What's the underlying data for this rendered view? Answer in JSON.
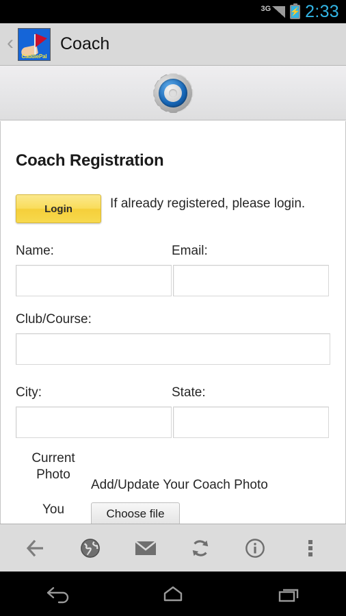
{
  "status_bar": {
    "network": "3G",
    "time": "2:33",
    "battery_icon": "battery-charging-icon",
    "signal_icon": "signal-bars-icon",
    "accent_color": "#33b5e5"
  },
  "title_bar": {
    "back_icon": "back-chevron-icon",
    "app_icon_label": "CaddiePal",
    "title": "Coach"
  },
  "banner": {
    "icon": "gear-icon"
  },
  "main": {
    "page_title": "Coach Registration",
    "login_button": "Login",
    "login_note": "If already registered, please login.",
    "fields": [
      {
        "label": "Name:",
        "value": "",
        "placeholder": ""
      },
      {
        "label": "Email:",
        "value": "",
        "placeholder": ""
      },
      {
        "label": "Club/Course:",
        "value": "",
        "placeholder": ""
      },
      {
        "label": "City:",
        "value": "",
        "placeholder": ""
      },
      {
        "label": "State:",
        "value": "",
        "placeholder": ""
      }
    ],
    "photo": {
      "current_photo_label": "Current\nPhoto",
      "current_photo_line1": "Current",
      "current_photo_line2": "Photo",
      "you_label": "You",
      "caption": "Add/Update Your Coach Photo",
      "choose_file_button": "Choose file"
    }
  },
  "toolbar": {
    "items": [
      {
        "name": "back-arrow-icon",
        "label": "Back"
      },
      {
        "name": "globe-icon",
        "label": "Browser"
      },
      {
        "name": "mail-icon",
        "label": "Mail"
      },
      {
        "name": "refresh-icon",
        "label": "Refresh"
      },
      {
        "name": "info-icon",
        "label": "Info"
      },
      {
        "name": "overflow-menu-icon",
        "label": "More"
      }
    ]
  },
  "nav_bar": {
    "items": [
      {
        "name": "android-back-icon",
        "label": "Back"
      },
      {
        "name": "android-home-icon",
        "label": "Home"
      },
      {
        "name": "android-recents-icon",
        "label": "Recents"
      }
    ]
  }
}
